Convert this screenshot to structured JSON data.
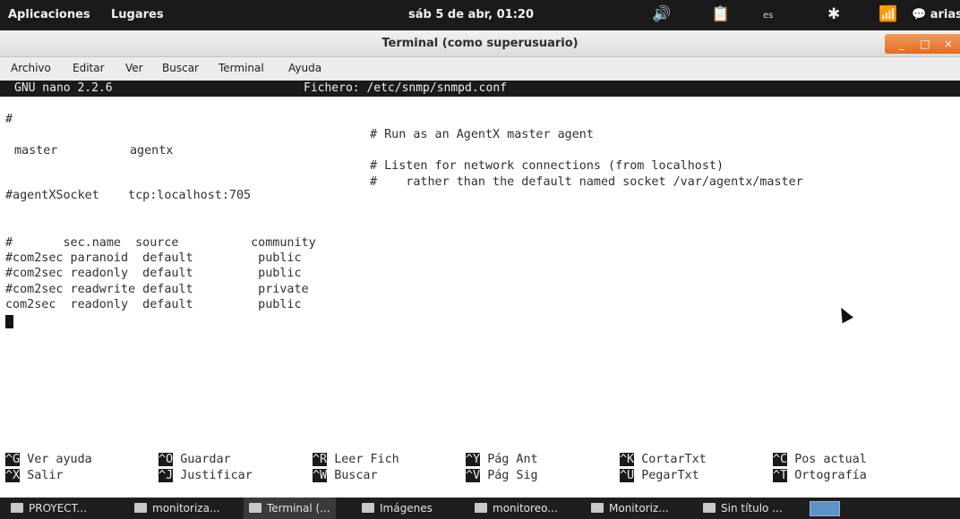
{
  "top_panel": {
    "menus": [
      "Aplicaciones",
      "Lugares"
    ],
    "clock": "sáb 5 de abr, 01:20",
    "icons": [
      "volume-icon",
      "clipboard-icon",
      "bluetooth-icon",
      "network-icon",
      "chat-icon"
    ],
    "keyboard_layout": "es",
    "user": "arias"
  },
  "window": {
    "title": "Terminal (como superusuario)",
    "controls": [
      "minimize",
      "maximize",
      "close"
    ]
  },
  "menubar": [
    "Archivo",
    "Editar",
    "Ver",
    "Buscar",
    "Terminal",
    "Ayuda"
  ],
  "nano": {
    "version": "GNU nano 2.2.6",
    "file": "Fichero: /etc/snmp/snmpd.conf",
    "lines": [
      "#",
      "# Run as an AgentX master agent",
      "master          agentx",
      "# Listen for network connections (from localhost)",
      "#    rather than the default named socket /var/agentx/master",
      "#agentXSocket    tcp:localhost:705",
      "#       sec.name  source          community",
      "#com2sec paranoid  default         public",
      "#com2sec readonly  default         public",
      "#com2sec readwrite default         private",
      "com2sec  readonly  default         public"
    ],
    "shortcuts": [
      {
        "key": "^G",
        "label": "Ver ayuda"
      },
      {
        "key": "^O",
        "label": "Guardar"
      },
      {
        "key": "^R",
        "label": "Leer Fich"
      },
      {
        "key": "^Y",
        "label": "Pág Ant"
      },
      {
        "key": "^K",
        "label": "CortarTxt"
      },
      {
        "key": "^C",
        "label": "Pos actual"
      },
      {
        "key": "^X",
        "label": "Salir"
      },
      {
        "key": "^J",
        "label": "Justificar"
      },
      {
        "key": "^W",
        "label": "Buscar"
      },
      {
        "key": "^V",
        "label": "Pág Sig"
      },
      {
        "key": "^U",
        "label": "PegarTxt"
      },
      {
        "key": "^T",
        "label": "Ortografía"
      }
    ]
  },
  "taskbar": [
    "PROYECT...",
    "monitoriza...",
    "Terminal (...",
    "Imágenes",
    "monitoreo...",
    "Monitoriz...",
    "Sin título ..."
  ],
  "colors": {
    "panel": "#1a1a1a",
    "window_controls": "#e36b1f",
    "terminal_bg": "#ffffff",
    "terminal_fg": "#303030"
  }
}
